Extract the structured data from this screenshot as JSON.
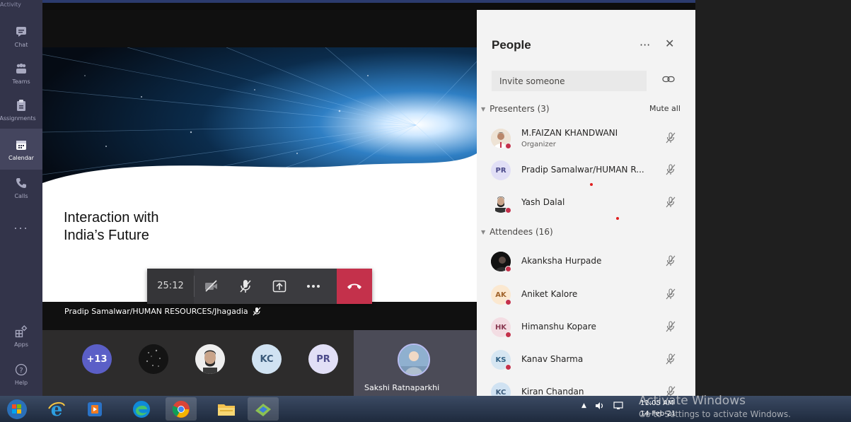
{
  "rail": {
    "top_cut": "Activity",
    "items": [
      {
        "label": "Chat",
        "icon": "chat-icon"
      },
      {
        "label": "Teams",
        "icon": "teams-icon"
      },
      {
        "label": "Assignments",
        "icon": "assignments-icon"
      },
      {
        "label": "Calendar",
        "icon": "calendar-icon"
      },
      {
        "label": "Calls",
        "icon": "calls-icon"
      },
      {
        "label": "Apps",
        "icon": "apps-icon"
      },
      {
        "label": "Help",
        "icon": "help-icon"
      }
    ],
    "more": "..."
  },
  "slide": {
    "title_line1": "Interaction with",
    "title_line2": "India’s Future"
  },
  "call": {
    "timer": "25:12"
  },
  "stage": {
    "presenter_label": "Pradip Samalwar/HUMAN RESOURCES/Jhagadia"
  },
  "strip": {
    "overflow_count": "+13",
    "initials_1": "KC",
    "initials_2": "PR",
    "self_name": "Sakshi Ratnaparkhi"
  },
  "panel": {
    "title": "People",
    "more": "···",
    "close": "✕",
    "invite_placeholder": "Invite someone",
    "presenters_label": "Presenters (3)",
    "mute_all": "Mute all",
    "attendees_label": "Attendees (16)",
    "presenters": [
      {
        "name": "M.FAIZAN KHANDWANI",
        "role": "Organizer"
      },
      {
        "name": "Pradip Samalwar/HUMAN R...",
        "initials": "PR"
      },
      {
        "name": "Yash Dalal"
      }
    ],
    "attendees": [
      {
        "name": "Akanksha Hurpade"
      },
      {
        "name": "Aniket Kalore",
        "initials": "AK"
      },
      {
        "name": "Himanshu Kopare",
        "initials": "HK"
      },
      {
        "name": "Kanav Sharma",
        "initials": "KS"
      },
      {
        "name": "Kiran Chandan",
        "initials": "KC"
      }
    ]
  },
  "taskbar": {
    "time": "11:05 AM",
    "date": "14-Feb-21",
    "activate_line1": "Activate Windows",
    "activate_line2": "Go to Settings to activate Windows."
  },
  "colors": {
    "rail": "#33344a",
    "hangup": "#c4314b",
    "panel": "#f3f3f3",
    "presence_busy": "#c4314b"
  }
}
